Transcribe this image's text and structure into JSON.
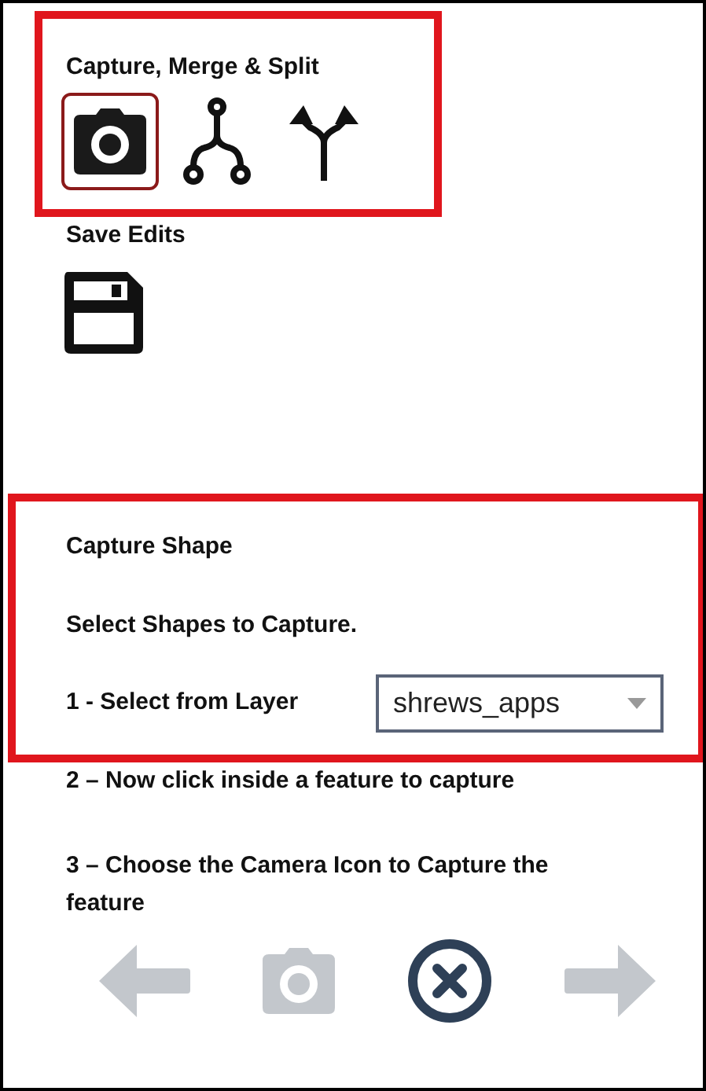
{
  "edit_tools": {
    "title": "Capture, Merge & Split",
    "highlighted": true,
    "tools": [
      {
        "kind": "capture",
        "selected": true
      },
      {
        "kind": "merge",
        "selected": false
      },
      {
        "kind": "split",
        "selected": false
      }
    ]
  },
  "save": {
    "title": "Save Edits"
  },
  "capture_shape": {
    "highlighted": true,
    "title": "Capture Shape",
    "subtitle": "Select Shapes to Capture.",
    "step_1": "1 - Select from Layer",
    "layer_select": {
      "value": "shrews_apps"
    }
  },
  "steps": [
    "2 – Now click inside a feature to capture",
    "3 – Choose the Camera Icon to Capture the feature"
  ],
  "nav_buttons": [
    {
      "kind": "back",
      "disabled": true
    },
    {
      "kind": "capture",
      "disabled": true
    },
    {
      "kind": "cancel",
      "disabled": false
    },
    {
      "kind": "forward",
      "disabled": true
    }
  ]
}
